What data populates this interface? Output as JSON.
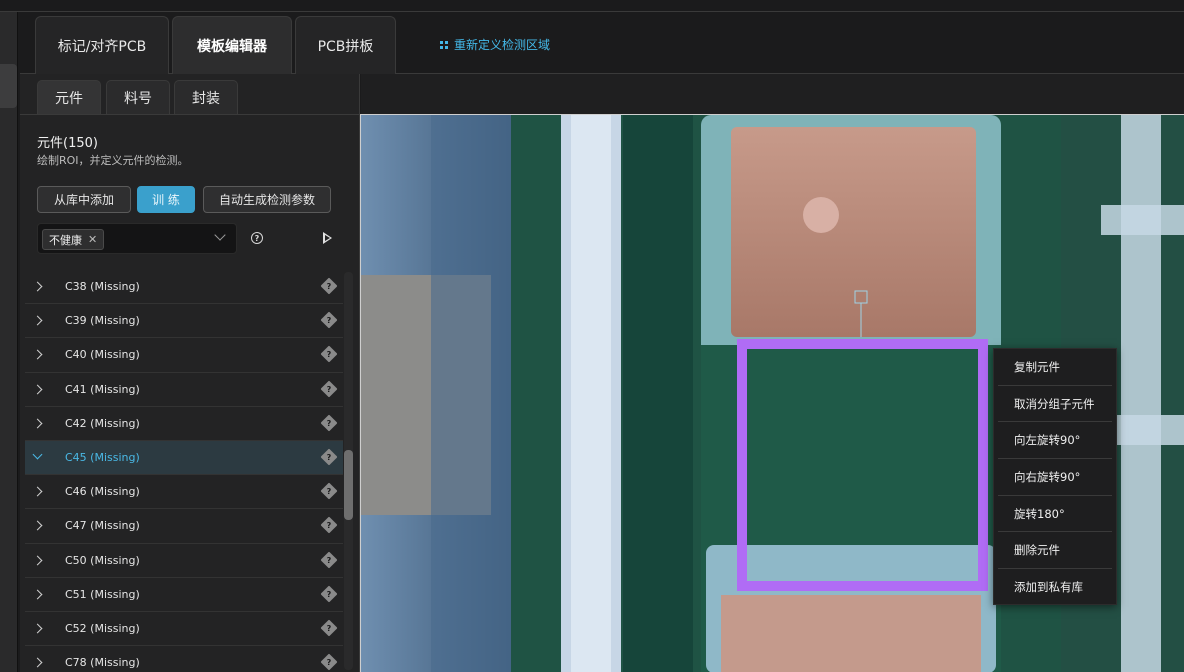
{
  "header": {
    "tabs": [
      {
        "label": "标记/对齐PCB",
        "active": false
      },
      {
        "label": "模板编辑器",
        "active": true
      },
      {
        "label": "PCB拼板",
        "active": false
      }
    ],
    "redefine_region": {
      "label": "重新定义检测区域",
      "icon": "grid-icon"
    }
  },
  "panel": {
    "subtabs": [
      {
        "label": "元件",
        "active": true
      },
      {
        "label": "料号",
        "active": false
      },
      {
        "label": "封装",
        "active": false
      }
    ],
    "title": "元件(150)",
    "description": "绘制ROI，并定义元件的检测。",
    "buttons": {
      "add_from_library": "从库中添加",
      "train": "训 练",
      "auto_generate": "自动生成检测参数"
    },
    "filter": {
      "chip": "不健康",
      "chip_remove_icon": "close-icon",
      "dropdown_icon": "chevron-down-icon"
    },
    "help_icon": "help-circle-icon",
    "run_icon": "play-icon",
    "items": [
      {
        "label": "C38 (Missing)",
        "expanded": false
      },
      {
        "label": "C39 (Missing)",
        "expanded": false
      },
      {
        "label": "C40 (Missing)",
        "expanded": false
      },
      {
        "label": "C41 (Missing)",
        "expanded": false
      },
      {
        "label": "C42 (Missing)",
        "expanded": false
      },
      {
        "label": "C45 (Missing)",
        "expanded": true
      },
      {
        "label": "C46 (Missing)",
        "expanded": false
      },
      {
        "label": "C47 (Missing)",
        "expanded": false
      },
      {
        "label": "C50 (Missing)",
        "expanded": false
      },
      {
        "label": "C51 (Missing)",
        "expanded": false
      },
      {
        "label": "C52 (Missing)",
        "expanded": false
      },
      {
        "label": "C78 (Missing)",
        "expanded": false
      }
    ],
    "warn_icon": "unknown-glyph-icon"
  },
  "canvas": {
    "roi_color": "#b06cf5"
  },
  "context_menu": {
    "items": [
      {
        "label": "复制元件"
      },
      {
        "label": "取消分组子元件"
      },
      {
        "label": "向左旋转90°"
      },
      {
        "label": "向右旋转90°"
      },
      {
        "label": "旋转180°"
      },
      {
        "label": "删除元件"
      },
      {
        "label": "添加到私有库"
      }
    ]
  },
  "colors": {
    "accent": "#44b8e8",
    "selected_row_text": "#4ab9e6",
    "train_button": "#3aa0cc"
  }
}
